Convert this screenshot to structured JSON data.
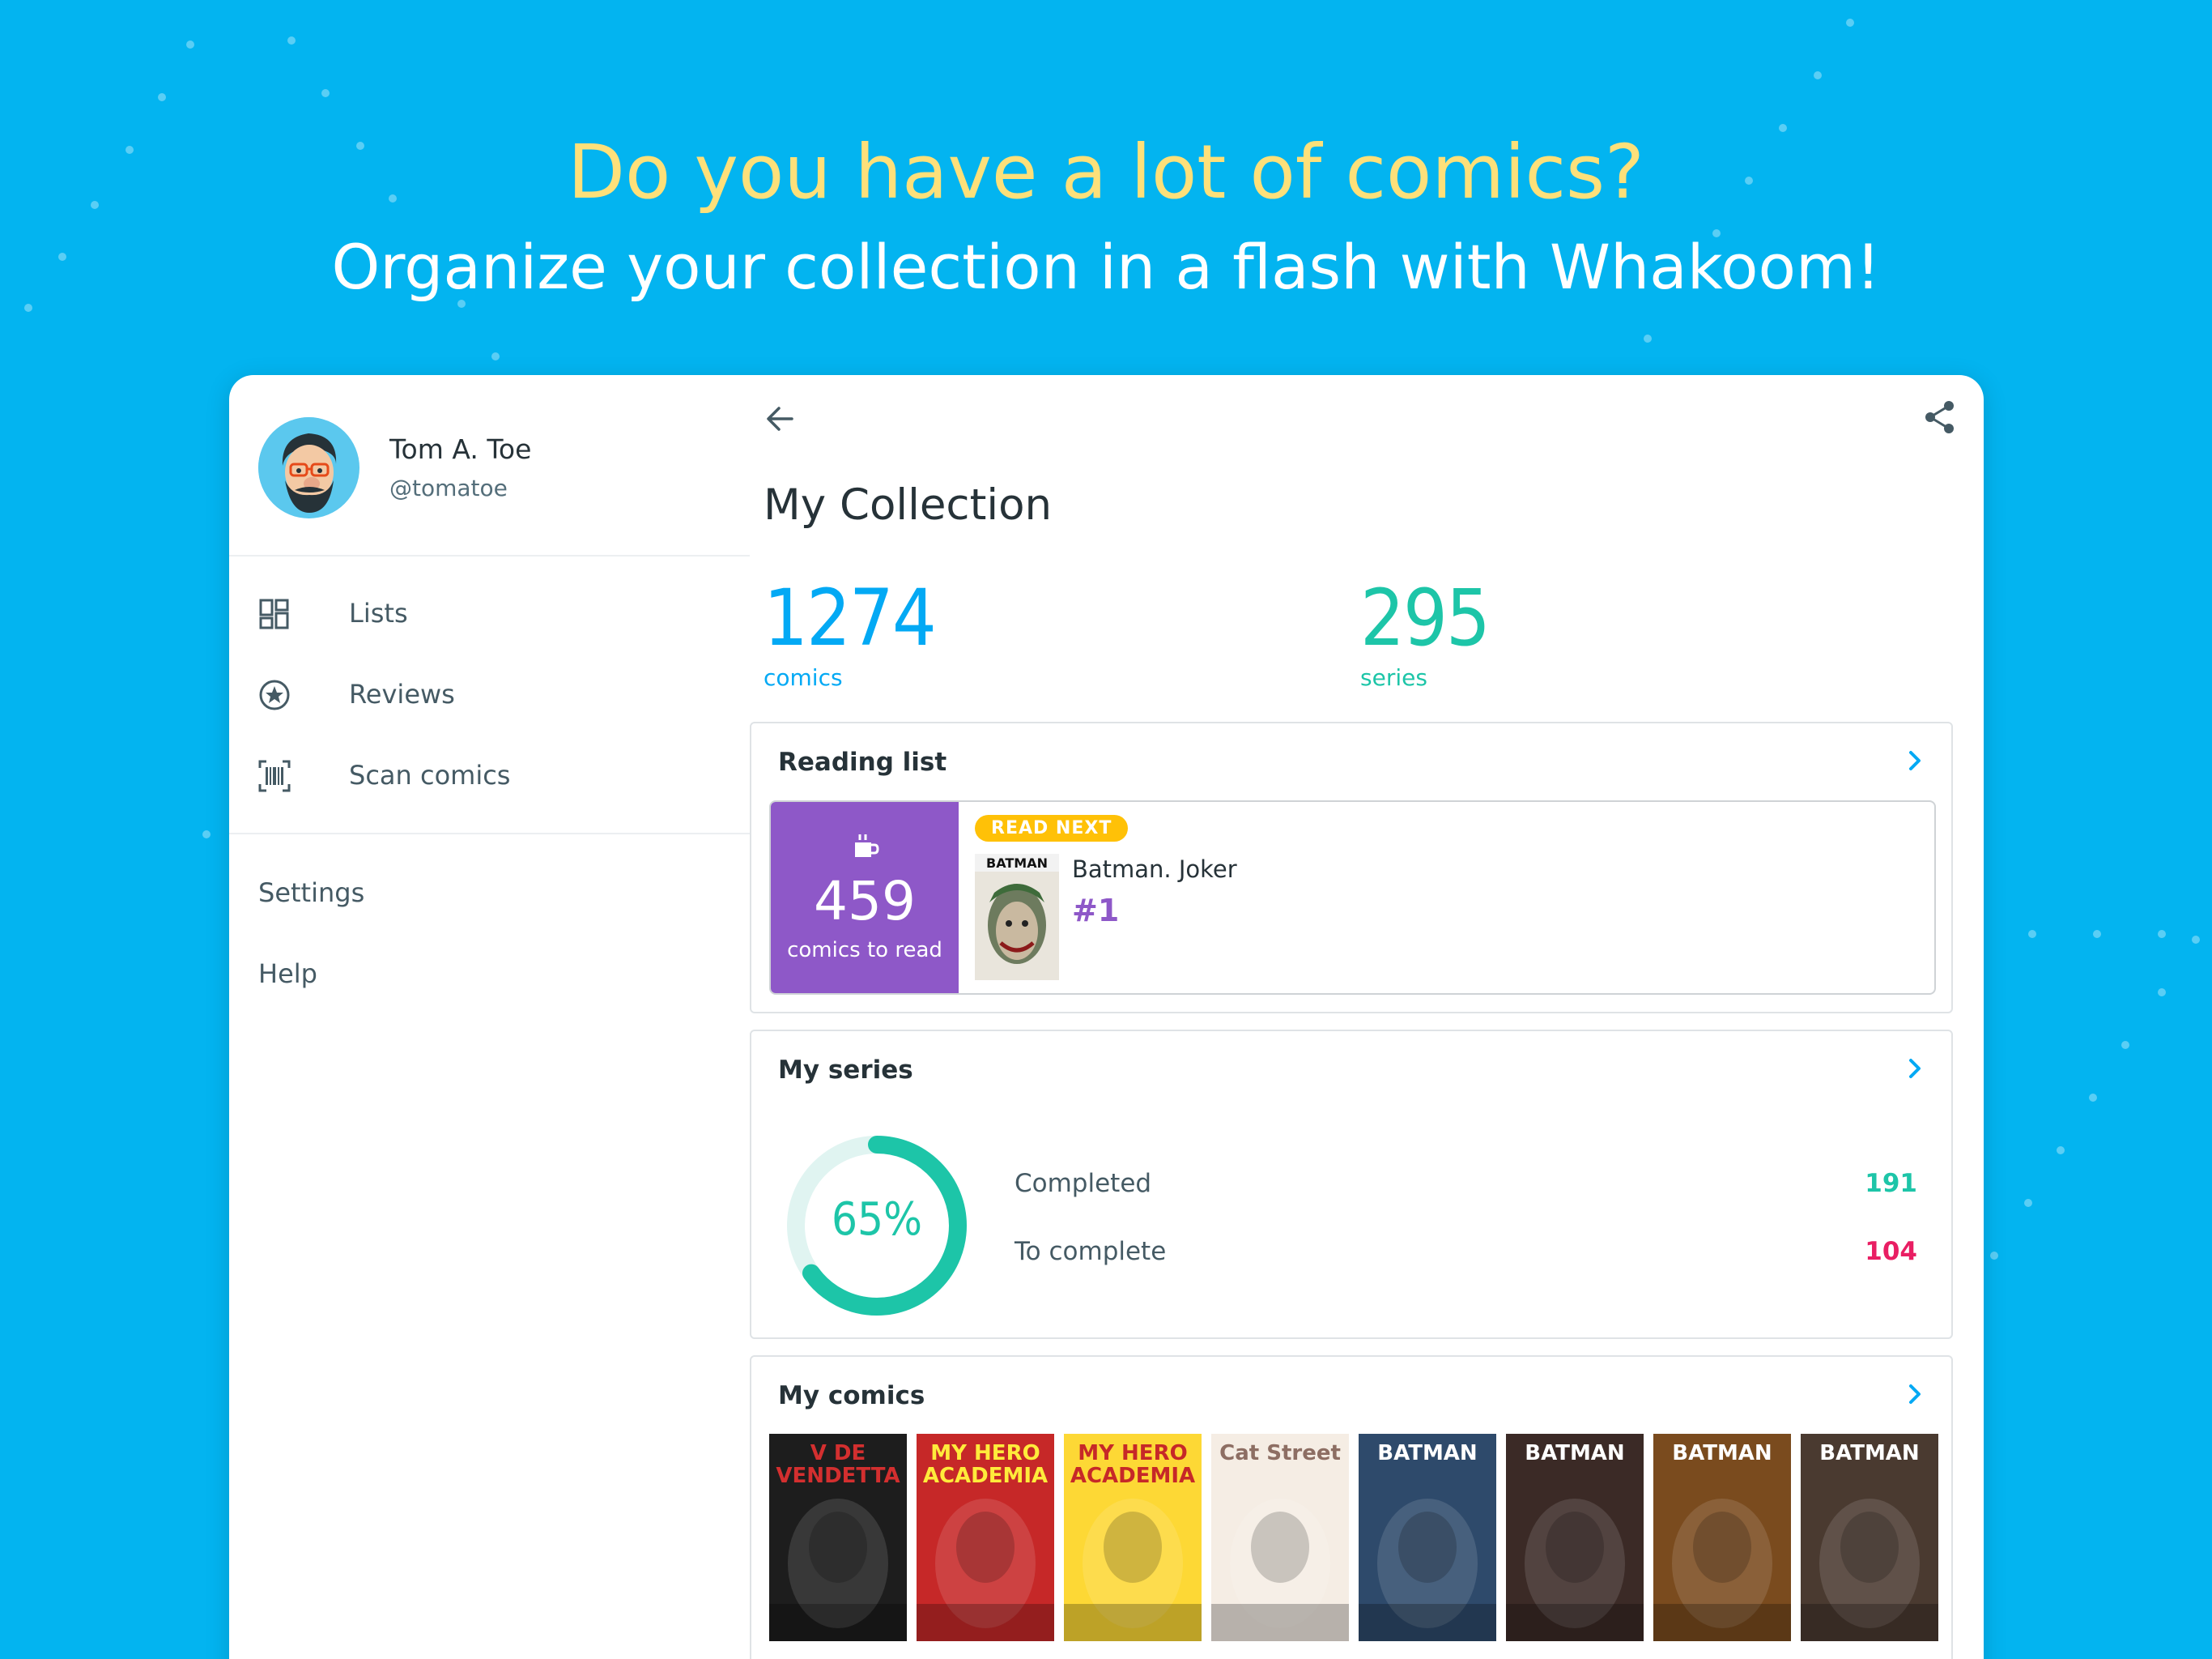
{
  "hero": {
    "title": "Do you have a lot of comics?",
    "subtitle": "Organize your collection in a flash with Whakoom!"
  },
  "colors": {
    "background": "#03b4f0",
    "headline": "#fde07a",
    "comics_accent": "#03a9f4",
    "series_accent": "#1dc5a8",
    "reading_purple": "#8e58c8",
    "to_complete_red": "#e91e63",
    "badge_yellow": "#ffc107"
  },
  "profile": {
    "name": "Tom A. Toe",
    "handle": "@tomatoe"
  },
  "nav": {
    "items": [
      {
        "label": "Lists",
        "icon": "dashboard-icon"
      },
      {
        "label": "Reviews",
        "icon": "star-circle-icon"
      },
      {
        "label": "Scan comics",
        "icon": "barcode-scan-icon"
      }
    ],
    "secondary": [
      "Settings",
      "Help"
    ]
  },
  "main": {
    "title": "My Collection",
    "stats": {
      "comics_count": "1274",
      "comics_label": "comics",
      "series_count": "295",
      "series_label": "series"
    },
    "reading_list": {
      "title": "Reading list",
      "to_read_count": "459",
      "to_read_label": "comics to read",
      "badge": "READ NEXT",
      "next_title": "Batman. Joker",
      "next_issue": "#1"
    },
    "my_series": {
      "title": "My series",
      "percent": 65,
      "percent_label": "65%",
      "completed_label": "Completed",
      "completed_value": "191",
      "to_complete_label": "To complete",
      "to_complete_value": "104"
    },
    "my_comics": {
      "title": "My comics",
      "covers": [
        {
          "name": "cover-v-de-vendetta",
          "text": "V DE VENDETTA",
          "bg": "#1d1d1d",
          "fg": "#d32f2f"
        },
        {
          "name": "cover-my-hero-academia-2",
          "text": "MY HERO ACADEMIA",
          "bg": "#c62828",
          "fg": "#ffeb3b"
        },
        {
          "name": "cover-my-hero-academia-1",
          "text": "MY HERO ACADEMIA",
          "bg": "#fdd835",
          "fg": "#c62828"
        },
        {
          "name": "cover-cat-street",
          "text": "Cat Street",
          "bg": "#f5ede4",
          "fg": "#8d6e63"
        },
        {
          "name": "cover-batman-a",
          "text": "BATMAN",
          "bg": "#2e4a6b",
          "fg": "#ffffff"
        },
        {
          "name": "cover-batman-b",
          "text": "BATMAN",
          "bg": "#3b2a26",
          "fg": "#ffffff"
        },
        {
          "name": "cover-batman-c",
          "text": "BATMAN",
          "bg": "#7a4b1e",
          "fg": "#ffffff"
        },
        {
          "name": "cover-batman-d",
          "text": "BATMAN",
          "bg": "#4a3a30",
          "fg": "#ffffff"
        }
      ]
    }
  }
}
